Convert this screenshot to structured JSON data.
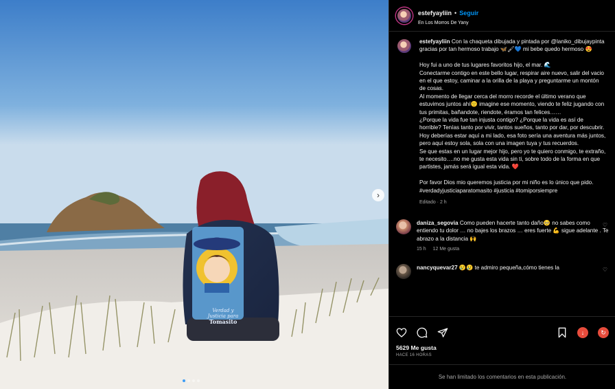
{
  "post": {
    "username": "estefyayliin",
    "separator": "•",
    "follow_label": "Seguir",
    "location": "En Los Morros De Yany",
    "image_description_icons": [
      "chevron-right-icon"
    ],
    "carousel": {
      "total": 4,
      "active_index": 0
    },
    "jacket_text": [
      "Verdad y",
      "Justicia para",
      "Tomasito"
    ]
  },
  "caption": {
    "username": "estefyayliin",
    "paragraphs": [
      "Con la chaqueta dibujada y pintada por @laniko_dibujaypinta gracias por tan hermoso trabajo 🦋🖌💙 mi bebe quedo hermoso 😍",
      "Hoy fui a uno de tus lugares favoritos hijo, el mar. 🌊\nConectarme contigo en este bello lugar, respirar aire nuevo, salir del vacio en el que estoy, caminar a la orilla de la playa y preguntarme un montón de cosas.\nAl momento de llegar cerca del morro recorde el último verano que estuvimos juntos ahí🙂 imagine ese momento, viendo te feliz jugando con tus primitas, bañandote, riendote, éramos tan felices……\n¿Porque la vida fue tan injusta contigo? ¿Porque la vida es así de horrible? Tenías tanto por vivir, tantos sueños, tanto por dar, por descubrir. Hoy deberías estar aquí a mi lado, esa foto sería una aventura más juntos, pero aquí estoy sola, sola con una imagen tuya y tus recuerdos.\nSe que estas en un lugar mejor hijo, pero yo te quiero conmigo, te extraño, te necesito….no me gusta esta vida sin ti, sobre todo de la forma en que partistes, jamás será igual esta vida. ❤️",
      "Por favor Dios mio queremos justicia por mi niño es lo único que pido.\n#verdadyjusticiaparatomasito #justicia #tomiporsiempre"
    ],
    "edited": "Editado · 2 h"
  },
  "comments": [
    {
      "username": "daniza_segovia",
      "text": "Como pueden hacerte tanto daño🥺 no sabes como entiendo tu dolor … no bajes los brazos … eres fuerte 💪 sigue adelante . Te abrazo a la distancia 🙌",
      "time": "15 h",
      "likes": "12 Me gusta",
      "avatar_color": "#c98a6a"
    },
    {
      "username": "nancyquevar27",
      "text": "😢😢 te admiro pequeña,cómo tienes la",
      "time": "",
      "likes": "",
      "avatar_color": "#6b5a4a"
    }
  ],
  "footer": {
    "likes": "5629 Me gusta",
    "ago": "HACE 16 HORAS",
    "limited": "Se han limitado los comentarios en esta publicación."
  },
  "colors": {
    "accent_blue": "#0095f6",
    "background": "#000000",
    "muted_text": "#a8a8a8",
    "divider": "#262626"
  }
}
